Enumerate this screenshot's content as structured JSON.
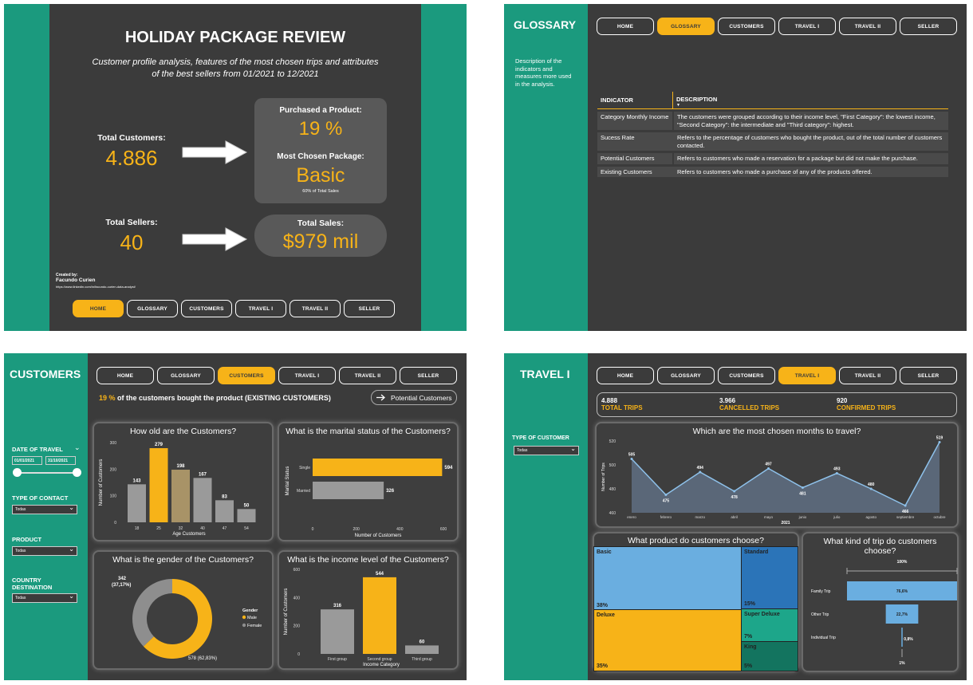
{
  "nav": [
    "HOME",
    "GLOSSARY",
    "CUSTOMERS",
    "TRAVEL I",
    "TRAVEL II",
    "SELLER"
  ],
  "home": {
    "title": "HOLIDAY PACKAGE REVIEW",
    "subtitle_1": "Customer profile analysis, features of the most chosen trips and attributes",
    "subtitle_2": "of the best sellers from 01/2021 to 12/2021",
    "total_customers_label": "Total Customers:",
    "total_customers_value": "4.886",
    "purchased_label": "Purchased a Product:",
    "purchased_value": "19 %",
    "package_label": "Most Chosen Package:",
    "package_value": "Basic",
    "package_note": "60% of Total Sales",
    "total_sellers_label": "Total Sellers:",
    "total_sellers_value": "40",
    "total_sales_label": "Total Sales:",
    "total_sales_value": "$979 mil",
    "created_by": "Created by:",
    "author": "Facundo Curien",
    "link": "https://www.linkedin.com/in/facundo-curien-data-analyst/"
  },
  "glossary": {
    "title": "GLOSSARY",
    "description": "Description of the indicators and measures more used in the analysis.",
    "col_indicator": "INDICATOR",
    "col_description": "DESCRIPTION",
    "rows": [
      {
        "indicator": "Category Monthly Income",
        "description": "The customers were grouped according to their income level, \"First Category\": the lowest income, \"Second Category\": the intermediate and \"Third category\": highest."
      },
      {
        "indicator": "Sucess Rate",
        "description": "Refers to the percentage of customers who bought the product, out of the total number of customers contacted."
      },
      {
        "indicator": "Potential Customers",
        "description": "Refers to customers who made a reservation for a package but did not make the purchase."
      },
      {
        "indicator": "Existing Customers",
        "description": "Refers to customers who made a purchase of any of the products offered."
      }
    ]
  },
  "customers": {
    "title": "CUSTOMERS",
    "headline_pct": "19 %",
    "headline_text": " of the customers bought the product (EXISTING CUSTOMERS)",
    "potential_btn": "Potential Customers",
    "filters": {
      "date_label": "DATE OF TRAVEL",
      "date_from": "01/01/2021",
      "date_to": "31/10/2021",
      "contact_label": "TYPE OF CONTACT",
      "contact_value": "Todas",
      "product_label": "PRODUCT",
      "product_value": "Todas",
      "country_label": "COUNTRY DESTINATION",
      "country_value": "Todas"
    },
    "age_title": "How old are the Customers?",
    "marital_title": "What is the marital status of the Customers?",
    "gender_title": "What is the gender of the Customers?",
    "income_title": "What is the income level of the Customers?"
  },
  "travel": {
    "title": "TRAVEL I",
    "kpis": [
      {
        "value": "4.888",
        "label": "TOTAL TRIPS"
      },
      {
        "value": "3.966",
        "label": "CANCELLED TRIPS"
      },
      {
        "value": "920",
        "label": "CONFIRMED TRIPS"
      }
    ],
    "filter_label": "TYPE OF CUSTOMER",
    "filter_value": "Todas",
    "months_title": "Which are the most chosen months to travel?",
    "product_title": "What product do customers choose?",
    "trip_title": "What kind of trip do customers choose?"
  },
  "chart_data": [
    {
      "type": "bar",
      "title": "How old are the Customers?",
      "xlabel": "Age Customers",
      "ylabel": "Number of Customers",
      "categories": [
        "18",
        "25",
        "32",
        "40",
        "47",
        "54"
      ],
      "values": [
        143,
        279,
        198,
        167,
        83,
        50
      ],
      "yticks": [
        "0",
        "100",
        "200",
        "300"
      ],
      "ylim": [
        0,
        300
      ]
    },
    {
      "type": "bar",
      "title": "What is the marital status of the Customers?",
      "orientation": "horizontal",
      "xlabel": "Number of Customers",
      "ylabel": "Marital Status",
      "categories": [
        "Single",
        "Married"
      ],
      "values": [
        594,
        326
      ],
      "xticks": [
        "0",
        "200",
        "400",
        "600"
      ],
      "xlim": [
        0,
        600
      ]
    },
    {
      "type": "pie",
      "title": "What is the gender of the Customers?",
      "legend_title": "Gender",
      "labels": [
        "Male",
        "Female"
      ],
      "values": [
        578,
        342
      ],
      "value_labels": [
        "578 (62,83%)",
        "342 (37,17%)"
      ],
      "colors": [
        "#f7b318",
        "#8e8e8e"
      ]
    },
    {
      "type": "bar",
      "title": "What is the income level of the Customers?",
      "xlabel": "Income Category",
      "ylabel": "Number of Customers",
      "categories": [
        "First group",
        "Second group",
        "Third group"
      ],
      "values": [
        316,
        544,
        60
      ],
      "yticks": [
        "0",
        "200",
        "400",
        "600"
      ],
      "ylim": [
        0,
        600
      ]
    },
    {
      "type": "area",
      "title": "Which are the most chosen months to travel?",
      "xlabel": "2021",
      "ylabel": "Number of Trips",
      "categories": [
        "enero",
        "febrero",
        "marzo",
        "abril",
        "mayo",
        "junio",
        "julio",
        "agosto",
        "septiembre",
        "octubre"
      ],
      "values": [
        505,
        475,
        494,
        478,
        497,
        481,
        493,
        480,
        466,
        519
      ],
      "yticks": [
        "460",
        "480",
        "500",
        "520"
      ],
      "ylim": [
        460,
        520
      ]
    },
    {
      "type": "treemap",
      "title": "What product do customers choose?",
      "labels": [
        "Basic",
        "Deluxe",
        "Standard",
        "Super Deluxe",
        "King"
      ],
      "values": [
        38,
        35,
        15,
        7,
        5
      ],
      "value_labels": [
        "38%",
        "35%",
        "15%",
        "7%",
        "5%"
      ]
    },
    {
      "type": "bar",
      "title": "What kind of trip do customers choose?",
      "orientation": "funnel",
      "top_label": "100%",
      "categories": [
        "Family Trip",
        "Other Trip",
        "Individual Trip"
      ],
      "values": [
        76.6,
        22.7,
        0.8
      ],
      "value_labels": [
        "76,6%",
        "22,7%",
        "0,8%"
      ],
      "bottom_label": "1%"
    }
  ]
}
